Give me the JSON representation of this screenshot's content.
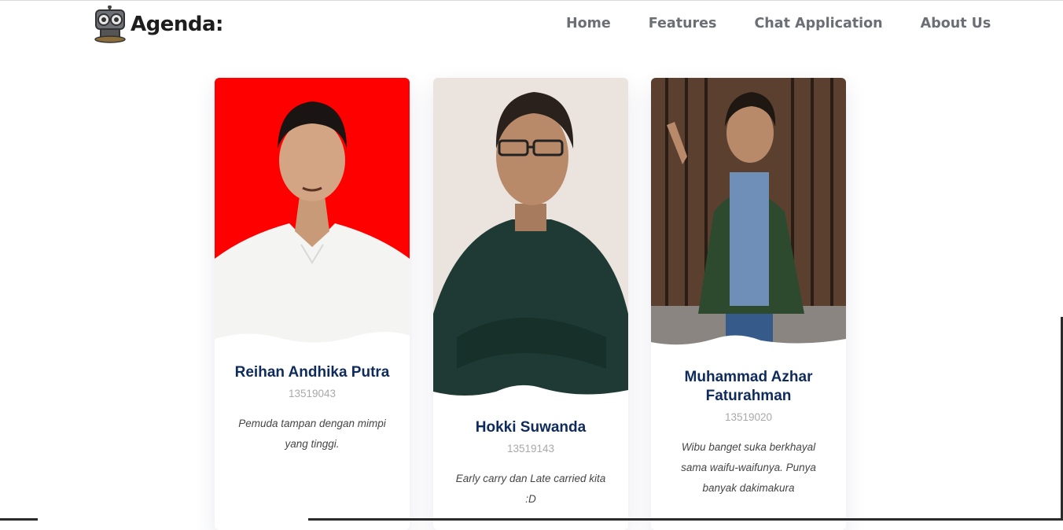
{
  "brand": {
    "name": "Agenda:"
  },
  "nav": {
    "items": [
      "Home",
      "Features",
      "Chat Application",
      "About Us"
    ]
  },
  "team": [
    {
      "name": "Reihan Andhika Putra",
      "nim": "13519043",
      "desc": "Pemuda tampan dengan mimpi yang tinggi."
    },
    {
      "name": "Hokki Suwanda",
      "nim": "13519143",
      "desc": "Early carry dan Late carried kita :D"
    },
    {
      "name": "Muhammad Azhar Faturahman",
      "nim": "13519020",
      "desc": "Wibu banget suka berkhayal sama waifu-waifunya. Punya banyak dakimakura"
    }
  ],
  "colors": {
    "name": "#0f2b5b",
    "nav": "#6b6e74",
    "nim": "#a9a9a9",
    "card1_bg": "#ff0000",
    "card2_bg": "#ebe3de",
    "card3_bg": "#5b4030"
  }
}
